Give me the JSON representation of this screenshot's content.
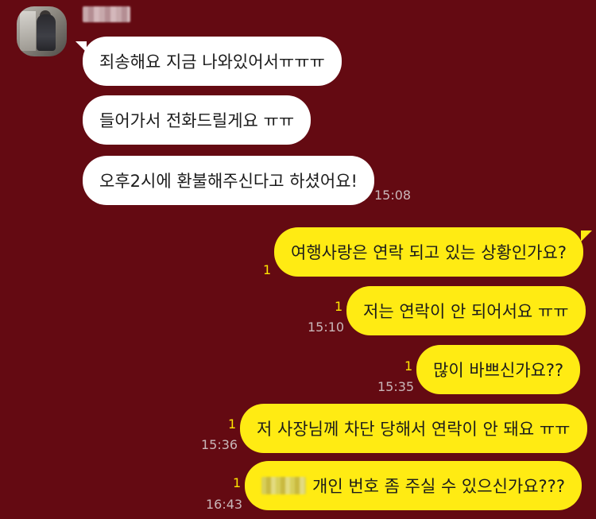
{
  "incoming": {
    "messages": [
      {
        "text": "죄송해요 지금 나와있어서ㅠㅠㅠ"
      },
      {
        "text": "들어가서 전화드릴게요 ㅠㅠ"
      },
      {
        "text": "오후2시에 환불해주신다고 하셨어요!"
      }
    ],
    "time": "15:08"
  },
  "outgoing": [
    {
      "text": "여행사랑은 연락 되고 있는 상황인가요?",
      "unread": "1",
      "time": ""
    },
    {
      "text": "저는 연락이 안 되어서요 ㅠㅠ",
      "unread": "1",
      "time": "15:10"
    },
    {
      "text": "많이 바쁘신가요??",
      "unread": "1",
      "time": "15:35"
    },
    {
      "text": "저 사장님께 차단 당해서 연락이 안 돼요 ㅠㅠ",
      "unread": "1",
      "time": "15:36"
    },
    {
      "text": "개인 번호 좀 주실 수 있으신가요???",
      "unread": "1",
      "time": "16:43"
    }
  ],
  "colors": {
    "background": "#640a12",
    "outgoing_bubble": "#ffeb13",
    "incoming_bubble": "#ffffff",
    "unread_count": "#ffe600"
  }
}
